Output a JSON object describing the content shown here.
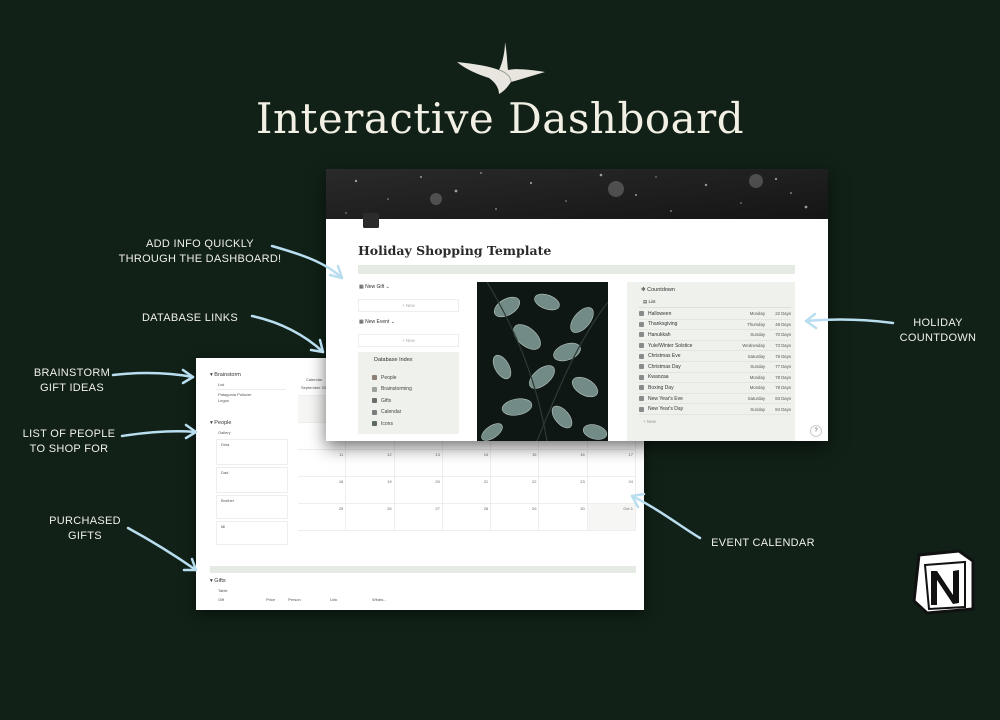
{
  "hero": {
    "title": "Interactive Dashboard"
  },
  "annotations": {
    "add_info": [
      "ADD INFO QUICKLY",
      "THROUGH THE DASHBOARD!"
    ],
    "database_links": [
      "DATABASE LINKS"
    ],
    "brainstorm": [
      "BRAINSTORM",
      "GIFT IDEAS"
    ],
    "people": [
      "LIST OF PEOPLE",
      "TO SHOP FOR"
    ],
    "purchased": [
      "PURCHASED",
      "GIFTS"
    ],
    "holiday_countdown": [
      "HOLIDAY",
      "COUNTDOWN"
    ],
    "event_calendar": [
      "EVENT CALENDAR"
    ]
  },
  "front": {
    "page_title": "Holiday Shopping Template",
    "new_gift": "New Gift",
    "new_event": "New Event",
    "new_label": "+ New",
    "db_index": {
      "title": "Database Index",
      "items": [
        "People",
        "Brainstorming",
        "Gifts",
        "Calendar",
        "Icons"
      ]
    },
    "countdown": {
      "title": "Countdown",
      "tab": "List",
      "rows": [
        {
          "name": "Halloween",
          "day": "Monday",
          "days": "22 Days"
        },
        {
          "name": "Thanksgiving",
          "day": "Thursday",
          "days": "48 Days"
        },
        {
          "name": "Hanukkah",
          "day": "Sunday",
          "days": "70 Days"
        },
        {
          "name": "Yule/Winter Solstice",
          "day": "Wednesday",
          "days": "73 Days"
        },
        {
          "name": "Christmas Eve",
          "day": "Saturday",
          "days": "76 Days"
        },
        {
          "name": "Christmas Day",
          "day": "Sunday",
          "days": "77 Days"
        },
        {
          "name": "Kwanzaa",
          "day": "Monday",
          "days": "78 Days"
        },
        {
          "name": "Boxing Day",
          "day": "Monday",
          "days": "78 Days"
        },
        {
          "name": "New Year's Eve",
          "day": "Saturday",
          "days": "83 Days"
        },
        {
          "name": "New Year's Day",
          "day": "Sunday",
          "days": "84 Days"
        }
      ],
      "new_label": "+ New"
    },
    "help": "?"
  },
  "back": {
    "brainstorm": {
      "title": "Brainstorm",
      "tab": "List",
      "items": [
        "Patagonia Pullover",
        "Legos"
      ]
    },
    "people": {
      "title": "People",
      "tab": "Gallery",
      "cards": [
        "Dina",
        "Dad",
        "Brother",
        "Mi"
      ]
    },
    "calendar": {
      "tab": "Calendar",
      "month": "September 2022",
      "week_numbers": [
        [
          "18",
          "19",
          "20",
          "21",
          "22",
          "23",
          "24"
        ],
        [
          "25",
          "26",
          "27",
          "28",
          "29",
          "30",
          "Oct 1"
        ]
      ],
      "row1": [
        "11",
        "12",
        "13",
        "14",
        "15",
        "16",
        "17"
      ],
      "row0": [
        "4",
        "5",
        "6",
        "7",
        "8",
        "9",
        "10"
      ]
    },
    "gifts": {
      "title": "Gifts",
      "tab": "Table",
      "cols": [
        "Gift",
        "Price",
        "Person",
        "Link",
        "Whats..."
      ]
    }
  }
}
